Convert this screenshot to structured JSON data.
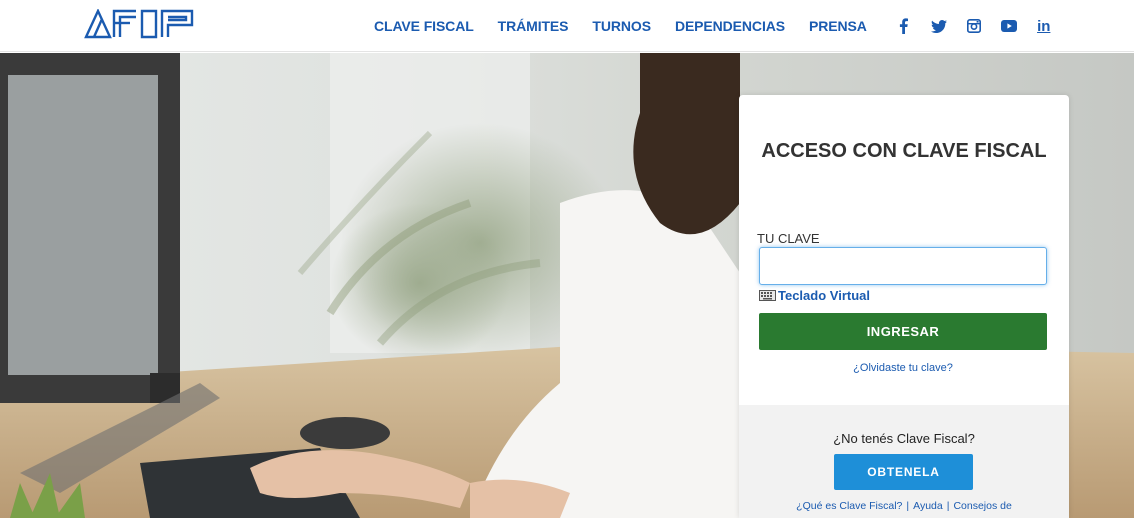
{
  "header": {
    "logo_text": "AFIP",
    "nav": [
      {
        "label": "CLAVE FISCAL"
      },
      {
        "label": "TRÁMITES"
      },
      {
        "label": "TURNOS"
      },
      {
        "label": "DEPENDENCIAS"
      },
      {
        "label": "PRENSA"
      }
    ],
    "social": [
      "facebook-icon",
      "twitter-icon",
      "instagram-icon",
      "youtube-icon",
      "linkedin-icon"
    ],
    "linkedin_label": "in"
  },
  "login": {
    "title": "ACCESO CON CLAVE FISCAL",
    "field_label": "TU CLAVE",
    "field_value": "",
    "virtual_keyboard": "Teclado Virtual",
    "submit_label": "INGRESAR",
    "forgot_label": "¿Olvidaste tu clave?",
    "no_clave_prompt": "¿No tenés Clave Fiscal?",
    "obtain_label": "OBTENELA",
    "links": {
      "what": "¿Qué es Clave Fiscal?",
      "help": "Ayuda",
      "tips": "Consejos de"
    }
  },
  "colors": {
    "brand_blue": "#1b5bb0",
    "submit_green": "#2a7a30",
    "obtain_blue": "#1e8fd8"
  }
}
